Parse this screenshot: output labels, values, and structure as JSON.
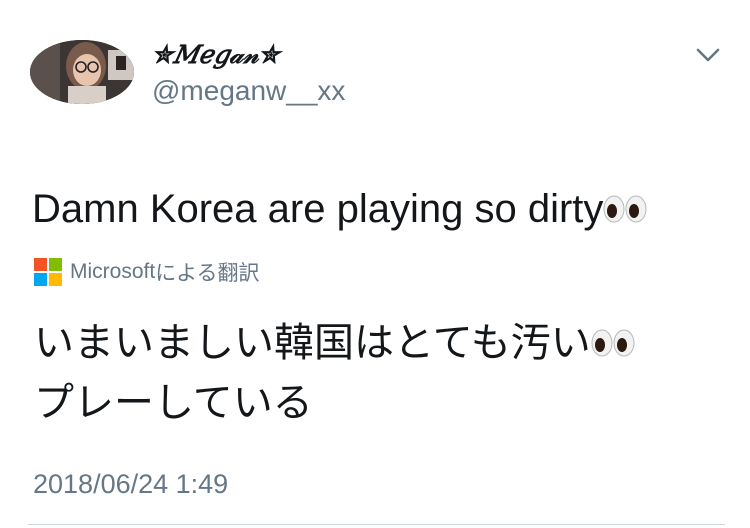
{
  "user": {
    "display_name": "✮𝑀𝑒𝑔𝒶𝓃✮",
    "handle": "@meganw__xx"
  },
  "menu": {
    "icon": "chevron-down-icon"
  },
  "tweet": {
    "text": "Damn Korea are playing so dirty",
    "emoji": "eyes-emoji"
  },
  "translation": {
    "provider": "Microsoft",
    "label_suffix": "による翻訳",
    "line1": "いまいましい韓国はとても汚い",
    "line2": "プレーしている"
  },
  "timestamp": "2018/06/24 1:49",
  "colors": {
    "text": "#14171a",
    "secondary": "#657786",
    "ms_red": "#f35325",
    "ms_green": "#81bc06",
    "ms_blue": "#05a6f0",
    "ms_yellow": "#ffba08"
  }
}
